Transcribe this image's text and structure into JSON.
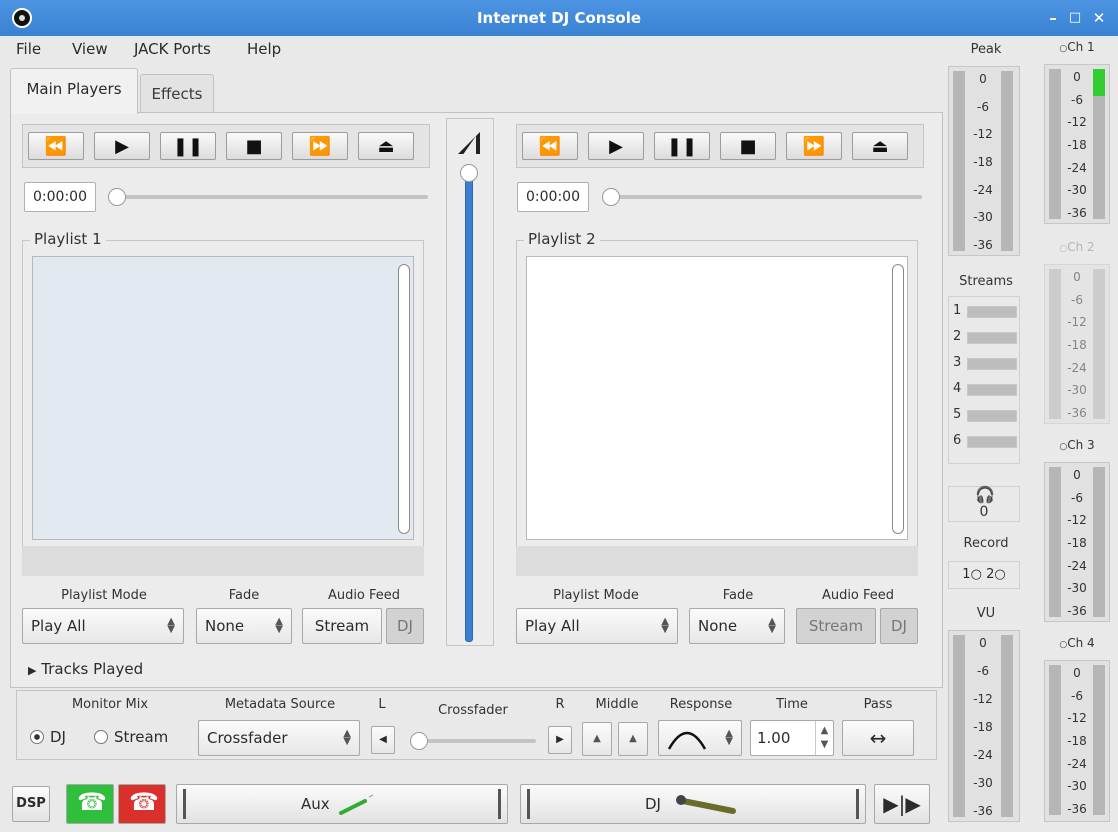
{
  "window": {
    "title": "Internet DJ Console"
  },
  "menu": [
    "File",
    "View",
    "JACK Ports",
    "Help"
  ],
  "tabs": [
    "Main Players",
    "Effects"
  ],
  "players": [
    {
      "time": "0:00:00",
      "playlist_title": "Playlist 1",
      "playlist_mode_label": "Playlist Mode",
      "playlist_mode": "Play All",
      "fade_label": "Fade",
      "fade": "None",
      "audio_feed_label": "Audio Feed",
      "stream_label": "Stream",
      "dj_label": "DJ"
    },
    {
      "time": "0:00:00",
      "playlist_title": "Playlist 2",
      "playlist_mode_label": "Playlist Mode",
      "playlist_mode": "Play All",
      "fade_label": "Fade",
      "fade": "None",
      "audio_feed_label": "Audio Feed",
      "stream_label": "Stream",
      "dj_label": "DJ"
    }
  ],
  "tracks_played": "Tracks Played",
  "mixer": {
    "monitor_mix_label": "Monitor Mix",
    "dj_option": "DJ",
    "stream_option": "Stream",
    "metadata_source_label": "Metadata Source",
    "metadata_source": "Crossfader",
    "l_label": "L",
    "crossfader_label": "Crossfader",
    "r_label": "R",
    "middle_label": "Middle",
    "response_label": "Response",
    "time_label": "Time",
    "time_value": "1.00",
    "pass_label": "Pass",
    "crossfader_position": 0.0
  },
  "meters": {
    "peak_label": "Peak",
    "peak_scale": [
      "0",
      "-6",
      "-12",
      "-18",
      "-24",
      "-30",
      "-36"
    ],
    "streams_label": "Streams",
    "streams": [
      "1",
      "2",
      "3",
      "4",
      "5",
      "6"
    ],
    "listeners": "0",
    "record_label": "Record",
    "record_1": "1",
    "record_2": "2",
    "vu_label": "VU",
    "vu_scale": [
      "0",
      "-6",
      "-12",
      "-18",
      "-24",
      "-30",
      "-36"
    ],
    "channels": [
      {
        "label": "Ch 1",
        "scale": [
          "0",
          "-6",
          "-12",
          "-18",
          "-24",
          "-30",
          "-36"
        ],
        "active": true
      },
      {
        "label": "Ch 2",
        "scale": [
          "0",
          "-6",
          "-12",
          "-18",
          "-24",
          "-30",
          "-36"
        ],
        "active": false
      },
      {
        "label": "Ch 3",
        "scale": [
          "0",
          "-6",
          "-12",
          "-18",
          "-24",
          "-30",
          "-36"
        ],
        "active": true
      },
      {
        "label": "Ch 4",
        "scale": [
          "0",
          "-6",
          "-12",
          "-18",
          "-24",
          "-30",
          "-36"
        ],
        "active": true
      }
    ]
  },
  "bottom_bar": {
    "dsp_label": "DSP",
    "aux_label": "Aux",
    "dj_label": "DJ"
  },
  "colors": {
    "titlebar": "#3d86d6",
    "volume_fill": "#3b7fd3",
    "meter_green": "#33cc33",
    "phone_green": "#2fbf3c",
    "phone_red": "#d9302c"
  }
}
